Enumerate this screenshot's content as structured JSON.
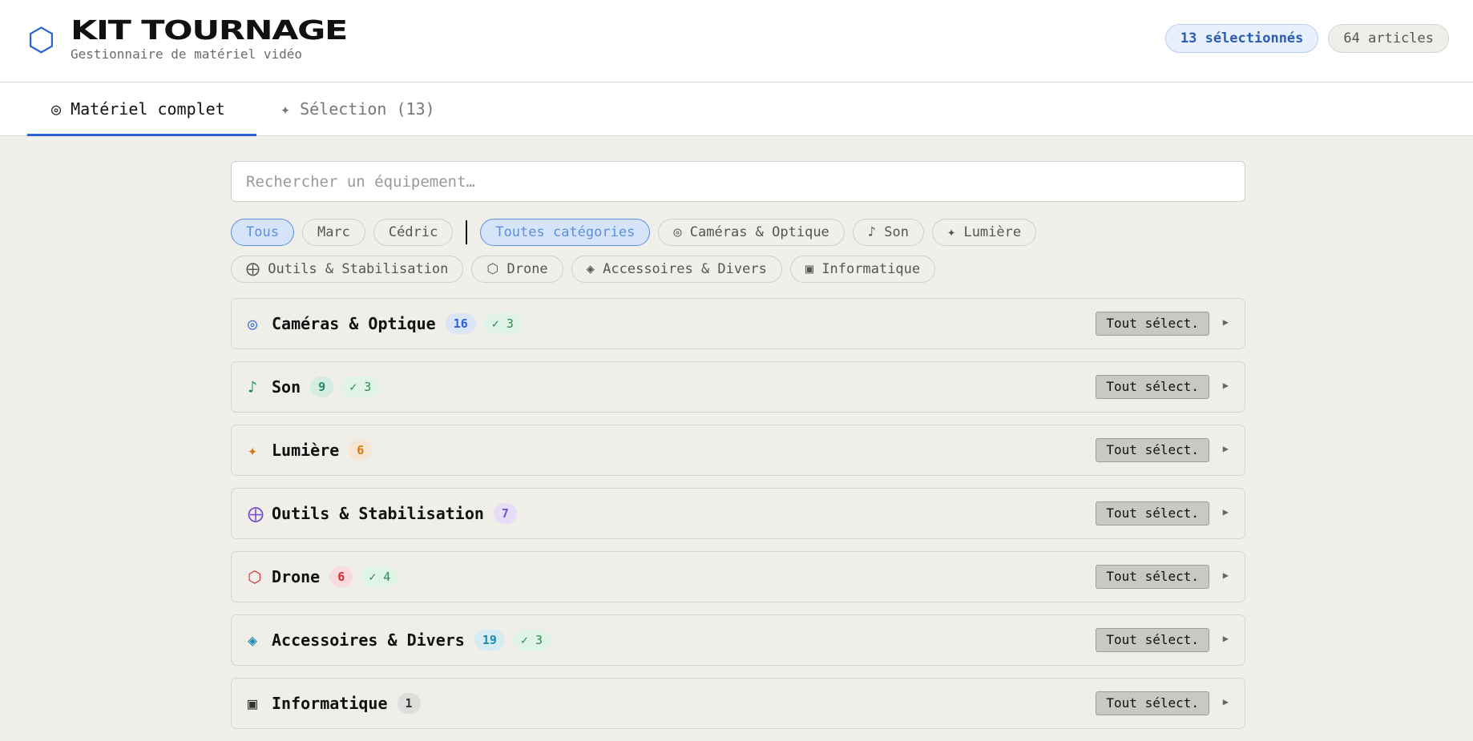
{
  "header": {
    "logo_icon": "⬡",
    "title": "KIT TOURNAGE",
    "subtitle": "Gestionnaire de matériel vidéo",
    "selected_badge": "13 sélectionnés",
    "articles_badge": "64 articles"
  },
  "tabs": {
    "all": "◎ Matériel complet",
    "selection": "✦ Sélection (13)"
  },
  "search": {
    "placeholder": "Rechercher un équipement…"
  },
  "filters": {
    "people": [
      "Tous",
      "Marc",
      "Cédric"
    ],
    "categories_row1": [
      "Toutes catégories",
      "◎ Caméras & Optique",
      "♪ Son",
      "✦ Lumière"
    ],
    "categories_row2": [
      "⨁ Outils & Stabilisation",
      "⬡ Drone",
      "◈ Accessoires & Divers",
      "▣ Informatique"
    ]
  },
  "select_all_label": "Tout sélect.",
  "categories": [
    {
      "icon": "◎",
      "name": "Caméras & Optique",
      "count": "16",
      "selected": "✓ 3",
      "color": "#2a62d9",
      "count_bg": "#dbe5f7"
    },
    {
      "icon": "♪",
      "name": "Son",
      "count": "9",
      "selected": "✓ 3",
      "color": "#1f8a63",
      "count_bg": "#d6ece3"
    },
    {
      "icon": "✦",
      "name": "Lumière",
      "count": "6",
      "selected": "",
      "color": "#d4780f",
      "count_bg": "#f5e6d3"
    },
    {
      "icon": "⨁",
      "name": "Outils & Stabilisation",
      "count": "7",
      "selected": "",
      "color": "#7a4fcf",
      "count_bg": "#e6def6"
    },
    {
      "icon": "⬡",
      "name": "Drone",
      "count": "6",
      "selected": "✓ 4",
      "color": "#d12f2f",
      "count_bg": "#f6dcdc"
    },
    {
      "icon": "◈",
      "name": "Accessoires & Divers",
      "count": "19",
      "selected": "✓ 3",
      "color": "#1a8ab0",
      "count_bg": "#d6ebf2"
    },
    {
      "icon": "▣",
      "name": "Informatique",
      "count": "1",
      "selected": "",
      "color": "#333333",
      "count_bg": "#dedddb"
    }
  ]
}
